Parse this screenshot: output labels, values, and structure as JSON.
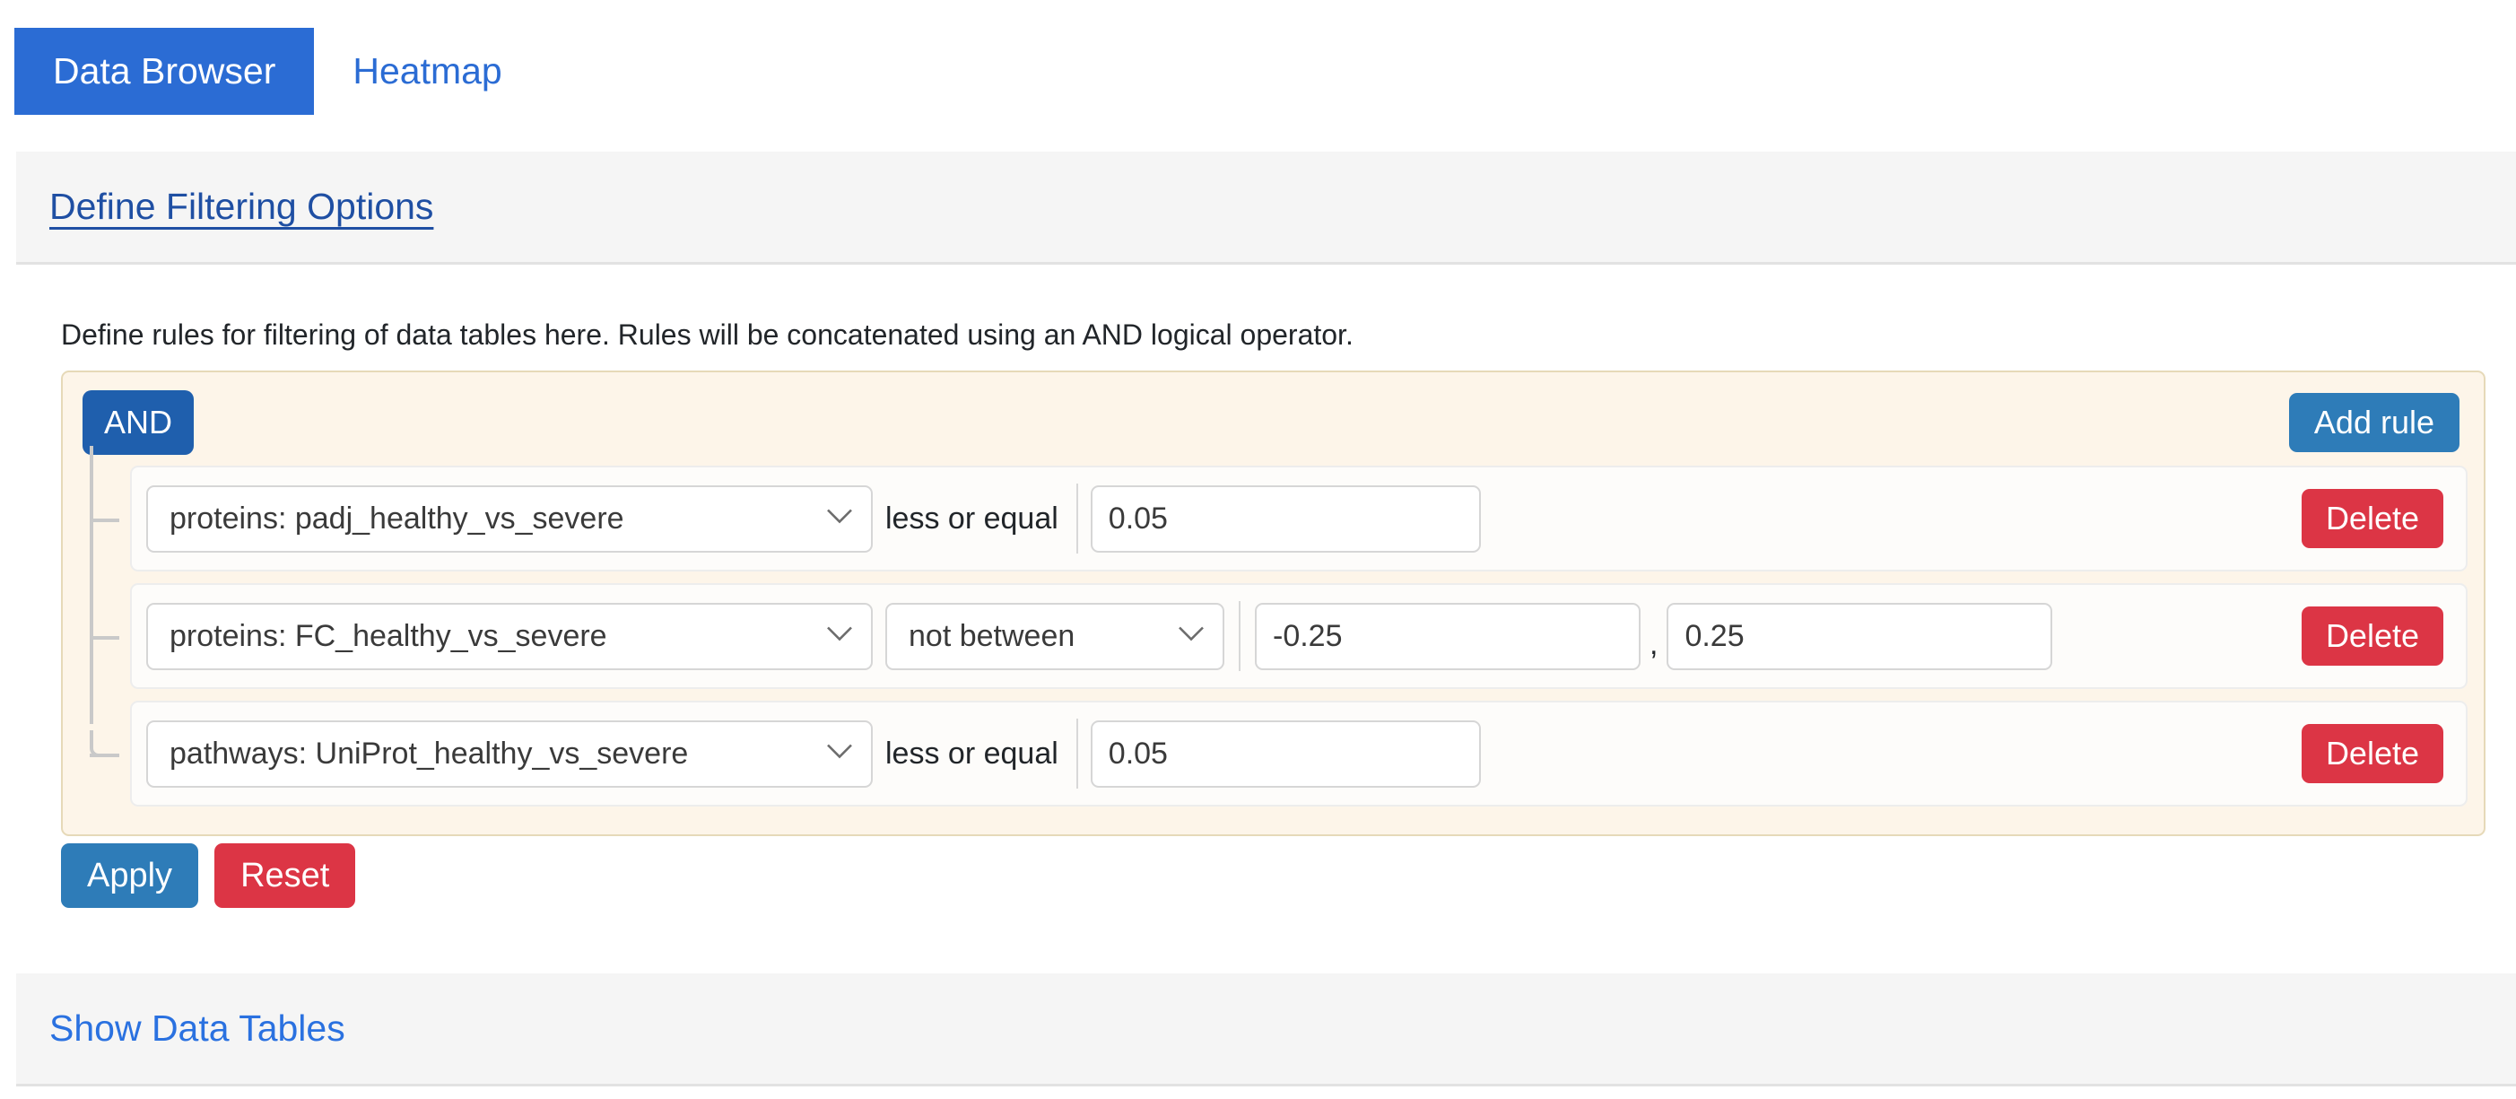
{
  "tabs": [
    {
      "label": "Data Browser",
      "active": true
    },
    {
      "label": "Heatmap",
      "active": false
    }
  ],
  "filter_panel": {
    "header_link": "Define Filtering Options",
    "description": "Define rules for filtering of data tables here. Rules will be concatenated using an AND logical operator.",
    "group_condition": "AND",
    "add_rule_label": "Add rule",
    "delete_label": "Delete",
    "rules": [
      {
        "field": "proteins: padj_healthy_vs_severe",
        "operator_label": "less or equal",
        "operator_is_select": false,
        "value1": "0.05",
        "value2": null
      },
      {
        "field": "proteins: FC_healthy_vs_severe",
        "operator_label": "not between",
        "operator_is_select": true,
        "value1": "-0.25",
        "value2": "0.25",
        "separator": ","
      },
      {
        "field": "pathways: UniProt_healthy_vs_severe",
        "operator_label": "less or equal",
        "operator_is_select": false,
        "value1": "0.05",
        "value2": null
      }
    ],
    "apply_label": "Apply",
    "reset_label": "Reset"
  },
  "tables_panel": {
    "header_link": "Show Data Tables"
  },
  "icons": {
    "chevron_down": "chevron-down-icon"
  },
  "colors": {
    "tab_active_bg": "#2b6cd4",
    "tab_inactive_text": "#2b6cd4",
    "panel_header_bg": "#f5f5f5",
    "panel_link": "#1f4fa3",
    "panel_link_plain": "#2a71e0",
    "group_bg": "#fdf5e9",
    "group_border": "#e6d9b8",
    "and_badge_bg": "#1f5fad",
    "add_rule_bg": "#2e7cb8",
    "delete_bg": "#dc3545",
    "apply_bg": "#2e7cb8",
    "reset_bg": "#dc3545",
    "rule_bg": "#fdfcfa",
    "tree_line": "#c9c9c9"
  }
}
